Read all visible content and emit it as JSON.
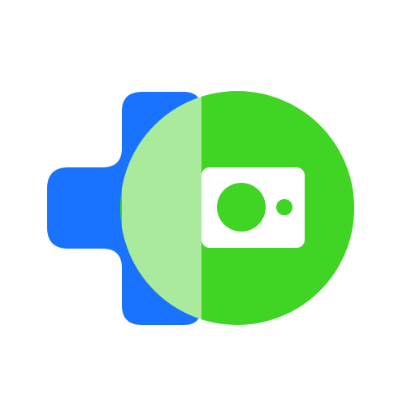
{
  "logo": {
    "name": "camera-plus-logo",
    "colors": {
      "background": "#ffffff",
      "plus_blue": "#1A73FF",
      "circle_green": "#40D424",
      "overlap_light_green": "#A9EA9D",
      "camera_body": "#ffffff",
      "camera_lens": "#40D424",
      "camera_flash": "#40D424"
    }
  }
}
